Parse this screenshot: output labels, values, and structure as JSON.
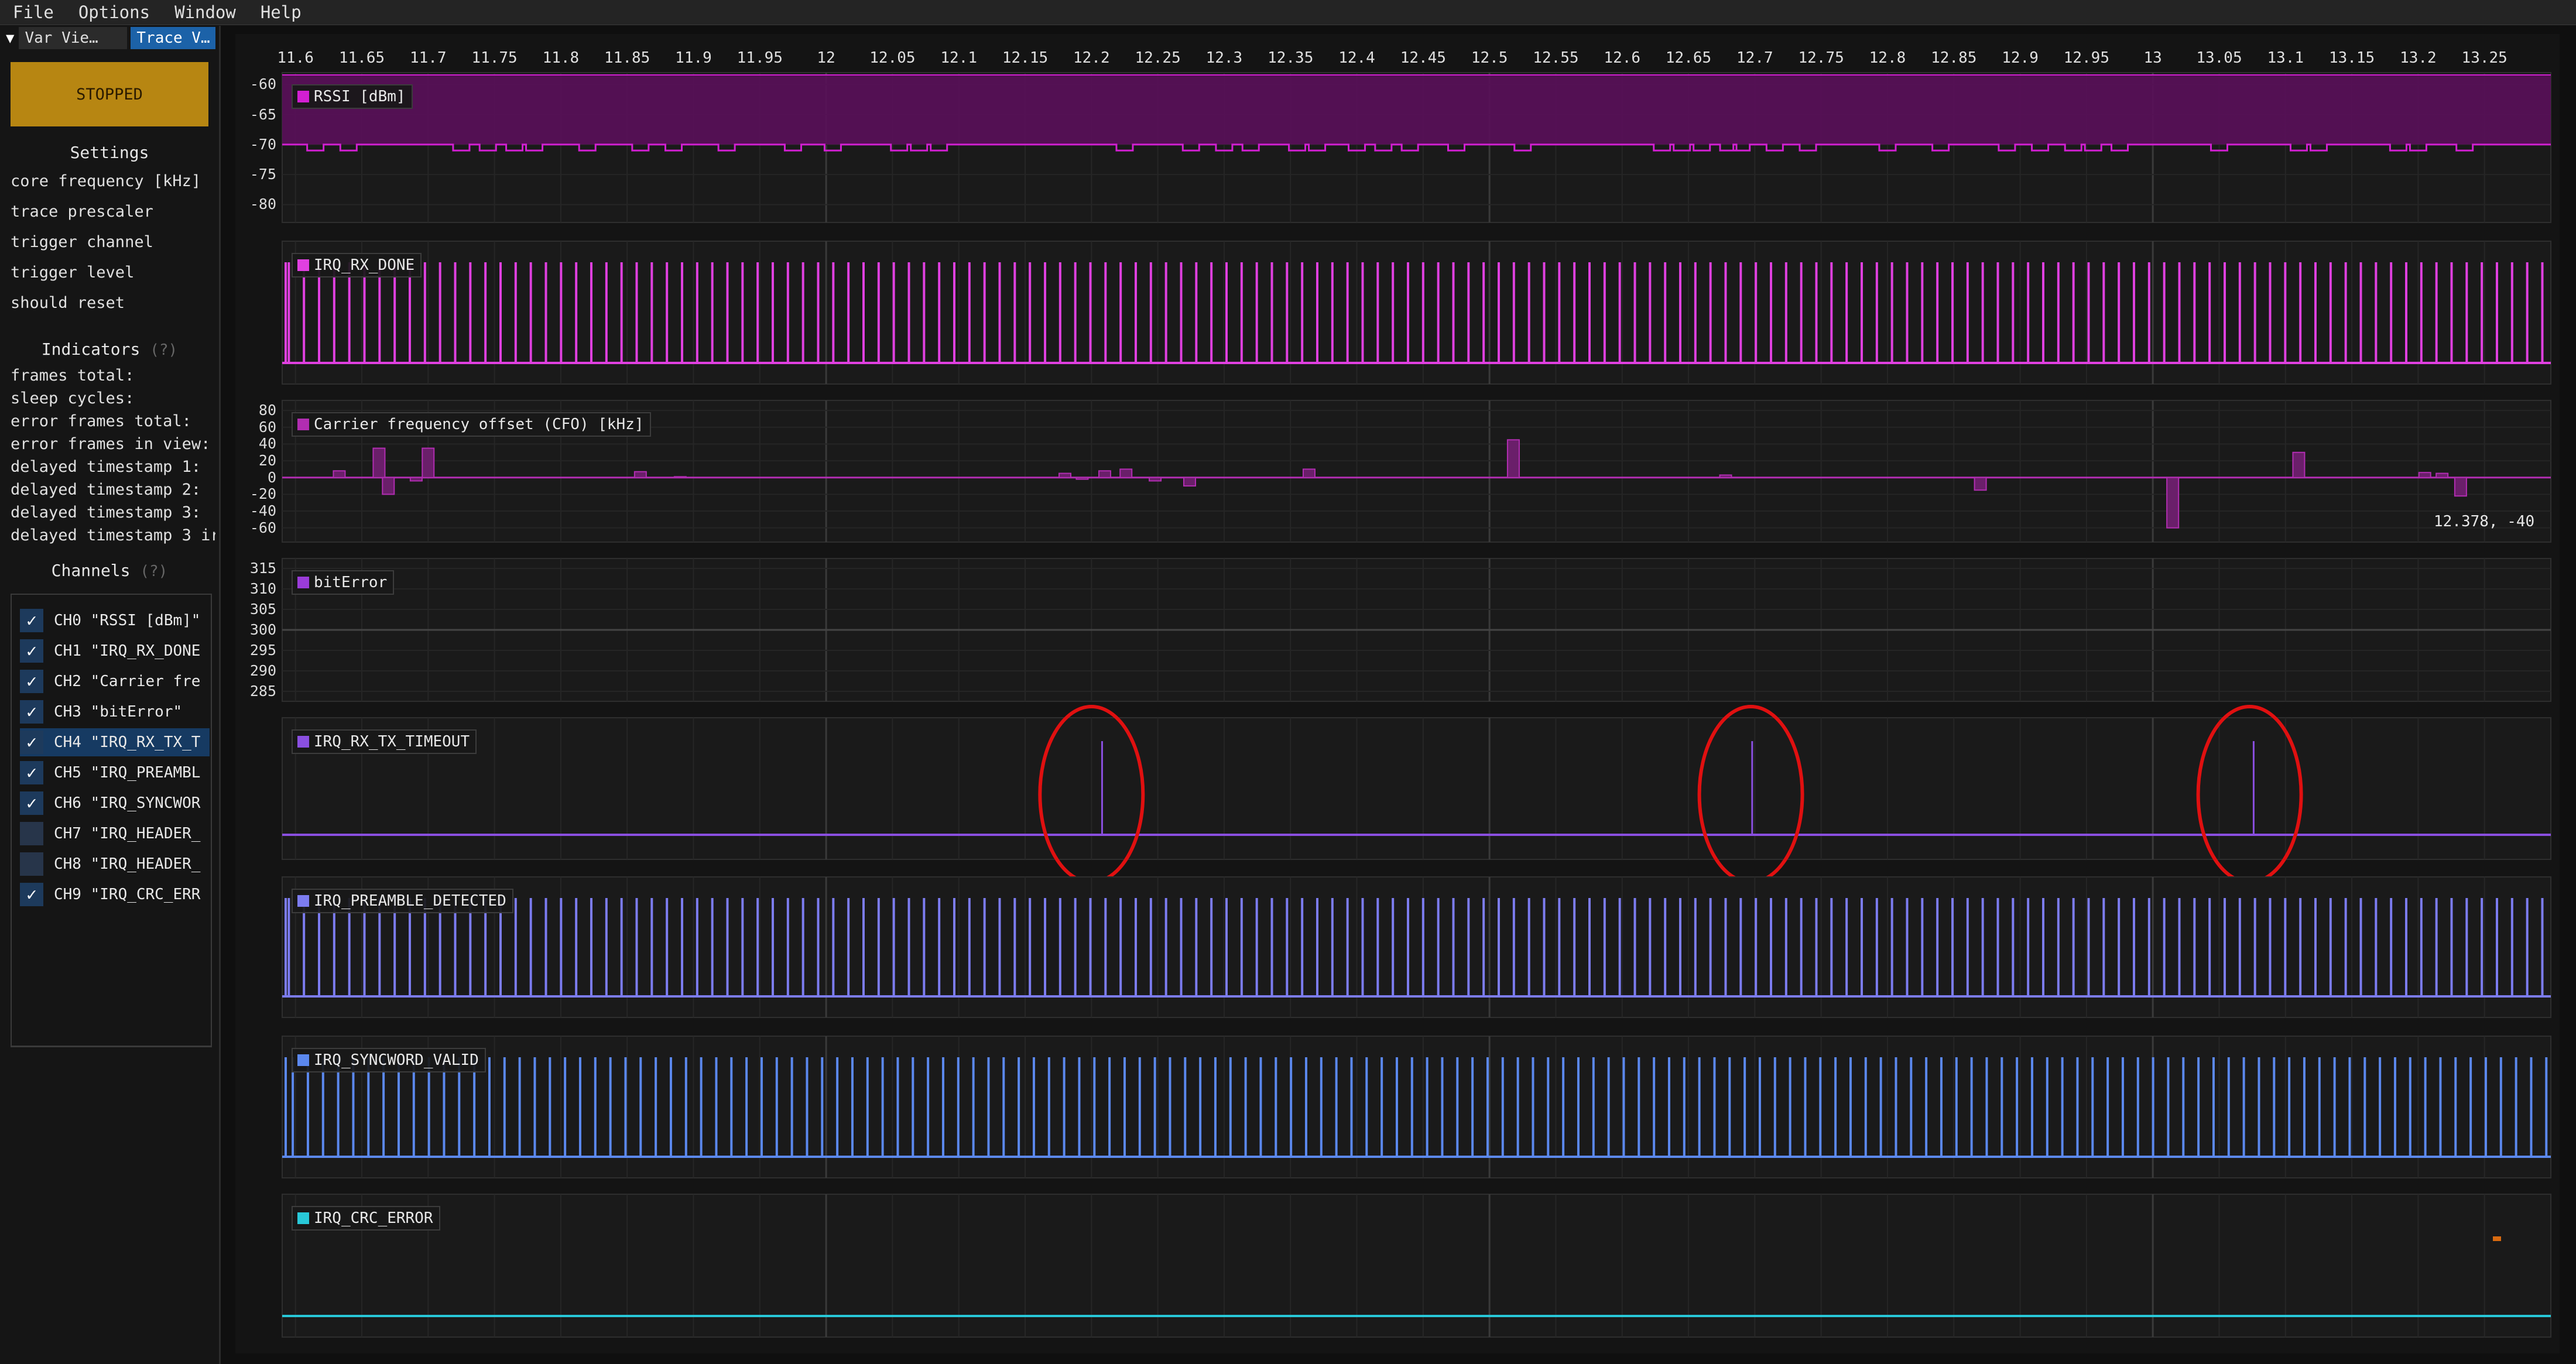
{
  "menu": [
    "File",
    "Options",
    "Window",
    "Help"
  ],
  "tabs": [
    {
      "label": "Var Vie…",
      "active": false
    },
    {
      "label": "Trace V…",
      "active": true
    }
  ],
  "state_button": {
    "label": "STOPPED",
    "color": "#b78612"
  },
  "settings": {
    "header": "Settings",
    "items": [
      "core frequency [kHz]",
      "trace prescaler",
      "trigger channel",
      "trigger level",
      "should reset"
    ]
  },
  "indicators": {
    "header": "Indicators",
    "help": "(?)",
    "items": [
      "frames total:",
      "sleep cycles:",
      "error frames total:",
      "error frames in view:",
      "delayed timestamp 1:",
      "delayed timestamp 2:",
      "delayed timestamp 3:",
      "delayed timestamp 3 ir"
    ]
  },
  "channels": {
    "header": "Channels",
    "help": "(?)",
    "items": [
      {
        "label": "CH0 \"RSSI [dBm]\"",
        "checked": true,
        "selected": false
      },
      {
        "label": "CH1 \"IRQ_RX_DONE",
        "checked": true,
        "selected": false
      },
      {
        "label": "CH2 \"Carrier fre",
        "checked": true,
        "selected": false
      },
      {
        "label": "CH3 \"bitError\"",
        "checked": true,
        "selected": false
      },
      {
        "label": "CH4 \"IRQ_RX_TX_T",
        "checked": true,
        "selected": true
      },
      {
        "label": "CH5 \"IRQ_PREAMBL",
        "checked": true,
        "selected": false
      },
      {
        "label": "CH6 \"IRQ_SYNCWOR",
        "checked": true,
        "selected": false
      },
      {
        "label": "CH7 \"IRQ_HEADER_",
        "checked": false,
        "selected": false
      },
      {
        "label": "CH8 \"IRQ_HEADER_",
        "checked": false,
        "selected": false
      },
      {
        "label": "CH9 \"IRQ_CRC_ERR",
        "checked": true,
        "selected": false
      }
    ]
  },
  "time_axis": {
    "ticks": [
      "11.6",
      "11.65",
      "11.7",
      "11.75",
      "11.8",
      "11.85",
      "11.9",
      "11.95",
      "12",
      "12.05",
      "12.1",
      "12.15",
      "12.2",
      "12.25",
      "12.3",
      "12.35",
      "12.4",
      "12.45",
      "12.5",
      "12.55",
      "12.6",
      "12.65",
      "12.7",
      "12.75",
      "12.8",
      "12.85",
      "12.9",
      "12.95",
      "13",
      "13.05",
      "13.1",
      "13.15",
      "13.2",
      "13.25"
    ],
    "range": [
      11.59,
      13.3
    ]
  },
  "hover_readout": "12.378, -40",
  "chart_data": [
    {
      "type": "area",
      "name": "RSSI [dBm]",
      "color": "#d21fd2",
      "y_ticks": [
        "-60",
        "-65",
        "-70",
        "-75",
        "-80"
      ],
      "ylim": [
        -82,
        -59
      ],
      "base": -70,
      "dips_to": -71,
      "dip_x": [
        11.615,
        11.64,
        11.725,
        11.745,
        11.765,
        11.78,
        11.82,
        11.86,
        11.885,
        11.925,
        11.975,
        12.005,
        12.055,
        12.07,
        12.085,
        12.225,
        12.275,
        12.3,
        12.32,
        12.355,
        12.37,
        12.4,
        12.42,
        12.44,
        12.475,
        12.525,
        12.63,
        12.645,
        12.66,
        12.68,
        12.69,
        12.715,
        12.74,
        12.8,
        12.84,
        12.89,
        12.915,
        12.94,
        12.955,
        12.975,
        13.05,
        13.11,
        13.125,
        13.185,
        13.2,
        13.235
      ]
    },
    {
      "type": "pulses",
      "name": "IRQ_RX_DONE",
      "color": "#e040e0",
      "start": 11.595,
      "period": 0.0114,
      "end": 13.3
    },
    {
      "type": "bar",
      "name": "Carrier frequency offset (CFO) [kHz]",
      "color": "#b12db1",
      "y_ticks": [
        "80",
        "60",
        "40",
        "20",
        "0",
        "-20",
        "-40",
        "-60"
      ],
      "ylim": [
        -70,
        85
      ],
      "points": [
        [
          11.633,
          8
        ],
        [
          11.663,
          35
        ],
        [
          11.67,
          -20
        ],
        [
          11.691,
          -4
        ],
        [
          11.7,
          35
        ],
        [
          11.86,
          7
        ],
        [
          11.89,
          1
        ],
        [
          12.18,
          5
        ],
        [
          12.193,
          -2
        ],
        [
          12.21,
          8
        ],
        [
          12.226,
          10
        ],
        [
          12.248,
          -4
        ],
        [
          12.274,
          -10
        ],
        [
          12.364,
          10
        ],
        [
          12.518,
          45
        ],
        [
          12.678,
          3
        ],
        [
          12.87,
          -15
        ],
        [
          13.015,
          -60
        ],
        [
          13.11,
          30
        ],
        [
          13.205,
          6
        ],
        [
          13.218,
          5
        ],
        [
          13.232,
          -22
        ]
      ]
    },
    {
      "type": "line",
      "name": "bitError",
      "color": "#9a3cd8",
      "y_ticks": [
        "315",
        "310",
        "305",
        "300",
        "295",
        "290",
        "285"
      ],
      "ylim": [
        284,
        316
      ],
      "y": 300
    },
    {
      "type": "pulses",
      "name": "IRQ_RX_TX_TIMEOUT",
      "color": "#8a4fe0",
      "x": [
        12.208,
        12.698,
        13.076
      ],
      "annotations": [
        12.2,
        12.697,
        13.073
      ],
      "annotation_color": "#e01010"
    },
    {
      "type": "pulses",
      "name": "IRQ_PREAMBLE_DETECTED",
      "color": "#7c7cf0",
      "start": 11.595,
      "period": 0.0114,
      "end": 13.3
    },
    {
      "type": "pulses",
      "name": "IRQ_SYNCWORD_VALID",
      "color": "#5b88ee",
      "start": 11.598,
      "period": 0.0114,
      "end": 13.3
    },
    {
      "type": "line",
      "name": "IRQ_CRC_ERROR",
      "color": "#28c8d8",
      "y": 0
    }
  ]
}
